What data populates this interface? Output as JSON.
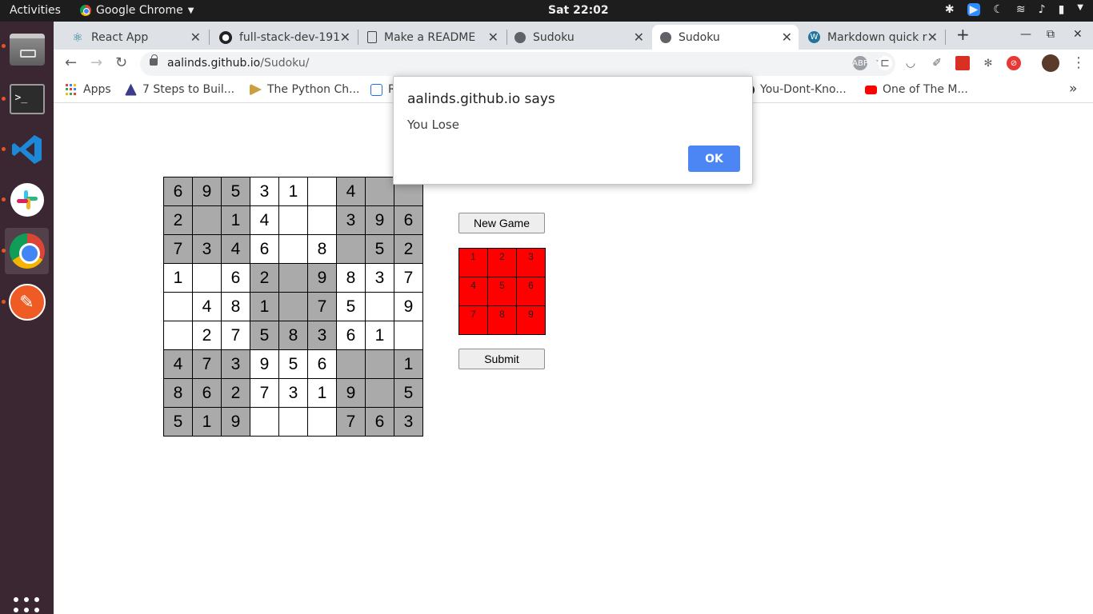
{
  "topbar": {
    "activities": "Activities",
    "app_name": "Google Chrome",
    "clock": "Sat 22:02"
  },
  "tabs": [
    {
      "title": "React App",
      "icon": "react-icon",
      "active": false
    },
    {
      "title": "full-stack-dev-191",
      "icon": "github-icon",
      "active": false
    },
    {
      "title": "Make a README",
      "icon": "document-icon",
      "active": false
    },
    {
      "title": "Sudoku",
      "icon": "globe-icon",
      "active": false
    },
    {
      "title": "Sudoku",
      "icon": "globe-icon",
      "active": true
    },
    {
      "title": "Markdown quick r",
      "icon": "wordpress-icon",
      "active": false
    }
  ],
  "toolbar": {
    "url_host": "aalinds.github.io",
    "url_path": "/Sudoku/"
  },
  "bookmarks": [
    {
      "label": "Apps",
      "icon": "apps-grid-icon"
    },
    {
      "label": "7 Steps to Buil...",
      "icon": "bookmark-icon"
    },
    {
      "label": "The Python Ch...",
      "icon": "python-icon"
    },
    {
      "label": "R",
      "icon": "page-icon"
    },
    {
      "label": "You-Dont-Kno...",
      "icon": "github-icon"
    },
    {
      "label": "One of The M...",
      "icon": "youtube-icon"
    }
  ],
  "sudoku": {
    "rows": [
      [
        "6",
        "9",
        "5",
        "3",
        "1",
        "",
        "4",
        "",
        ""
      ],
      [
        "2",
        "",
        "1",
        "4",
        "",
        "",
        "3",
        "9",
        "6"
      ],
      [
        "7",
        "3",
        "4",
        "6",
        "",
        "8",
        "",
        "5",
        "2"
      ],
      [
        "1",
        "",
        "6",
        "2",
        "",
        "9",
        "8",
        "3",
        "7"
      ],
      [
        "",
        "4",
        "8",
        "1",
        "",
        "7",
        "5",
        "",
        "9"
      ],
      [
        "",
        "2",
        "7",
        "5",
        "8",
        "3",
        "6",
        "1",
        ""
      ],
      [
        "4",
        "7",
        "3",
        "9",
        "5",
        "6",
        "",
        "",
        "1"
      ],
      [
        "8",
        "6",
        "2",
        "7",
        "3",
        "1",
        "9",
        "",
        "5"
      ],
      [
        "5",
        "1",
        "9",
        "",
        "",
        "",
        "7",
        "6",
        "3"
      ]
    ]
  },
  "controls": {
    "new_game": "New Game",
    "submit": "Submit",
    "numpad": [
      "1",
      "2",
      "3",
      "4",
      "5",
      "6",
      "7",
      "8",
      "9"
    ],
    "numpad_color": "#ff0000"
  },
  "dialog": {
    "origin": "aalinds.github.io says",
    "message": "You Lose",
    "ok": "OK",
    "ok_color": "#4c86f5"
  }
}
